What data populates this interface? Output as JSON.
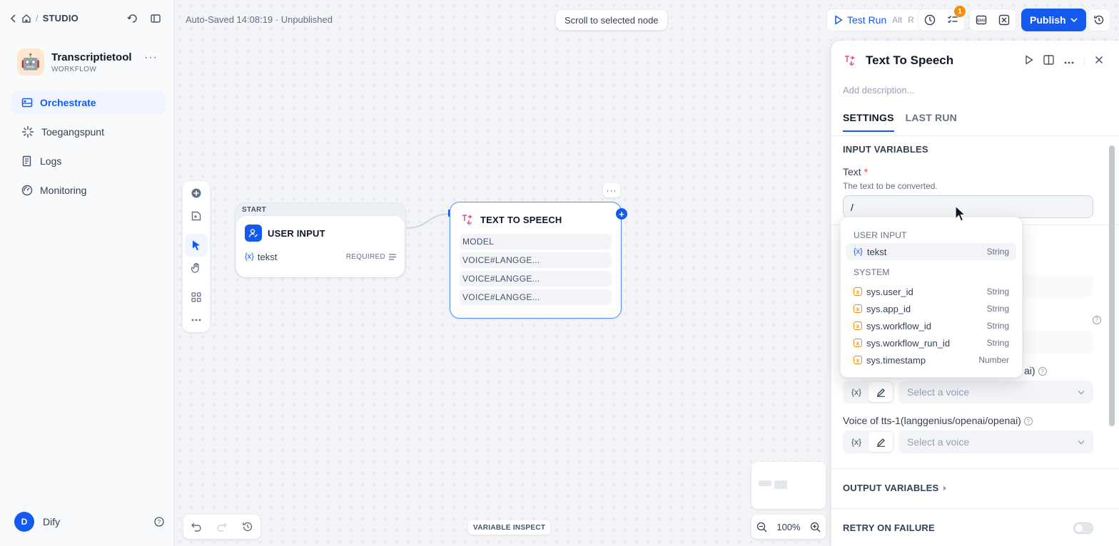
{
  "breadcrumb": {
    "studio": "STUDIO"
  },
  "app": {
    "name": "Transcriptietool",
    "type": "WORKFLOW",
    "icon": "robot-emoji",
    "avatar_emoji": "🤖"
  },
  "sidebar": {
    "items": [
      {
        "label": "Orchestrate",
        "icon": "orchestrate-icon",
        "active": true
      },
      {
        "label": "Toegangspunt",
        "icon": "api-access-icon",
        "active": false
      },
      {
        "label": "Logs",
        "icon": "logs-icon",
        "active": false
      },
      {
        "label": "Monitoring",
        "icon": "monitoring-icon",
        "active": false
      }
    ]
  },
  "user": {
    "initial": "D",
    "name": "Dify"
  },
  "header": {
    "autosave": "Auto-Saved 14:08:19 · Unpublished",
    "scroll_to_selected": "Scroll to selected node",
    "test_run": {
      "label": "Test Run",
      "shortcut_1": "Alt",
      "shortcut_2": "R"
    },
    "checklist_badge": "1",
    "publish": "Publish"
  },
  "nodes": {
    "start": {
      "badge": "START",
      "title": "USER INPUT",
      "variable": {
        "symbol": "{x}",
        "name": "tekst",
        "flag": "REQUIRED"
      }
    },
    "tts": {
      "title": "TEXT TO SPEECH",
      "fields": [
        "MODEL",
        "VOICE#LANGGE...",
        "VOICE#LANGGE...",
        "VOICE#LANGGE..."
      ],
      "more": "···",
      "plus": "+"
    }
  },
  "canvas": {
    "variable_inspect": "VARIABLE INSPECT",
    "zoom": "100%"
  },
  "panel": {
    "title": "Text To Speech",
    "description_placeholder": "Add description...",
    "tabs": [
      "SETTINGS",
      "LAST RUN"
    ],
    "input_variables": "INPUT VARIABLES",
    "text_field": {
      "label": "Text",
      "required": "*",
      "help": "The text to be converted.",
      "value": "/"
    },
    "voice_fields": [
      {
        "label": "Voice of tts-1(langgenius/openai/openai)",
        "placeholder": "Select a voice"
      },
      {
        "label": "Voice of tts-1(langgenius/openai/openai)",
        "placeholder": "Select a voice"
      }
    ],
    "voice_label_tail": "ai)",
    "var_toggle": "{x}",
    "output_variables": "OUTPUT VARIABLES",
    "retry_on_failure": "RETRY ON FAILURE"
  },
  "dropdown": {
    "groups": [
      {
        "name": "USER INPUT",
        "items": [
          {
            "name": "tekst",
            "type": "String",
            "kind": "user"
          }
        ]
      },
      {
        "name": "SYSTEM",
        "items": [
          {
            "name": "sys.user_id",
            "type": "String",
            "kind": "system"
          },
          {
            "name": "sys.app_id",
            "type": "String",
            "kind": "system"
          },
          {
            "name": "sys.workflow_id",
            "type": "String",
            "kind": "system"
          },
          {
            "name": "sys.workflow_run_id",
            "type": "String",
            "kind": "system"
          },
          {
            "name": "sys.timestamp",
            "type": "Number",
            "kind": "system"
          }
        ]
      }
    ]
  },
  "colors": {
    "accent": "#155aef",
    "system_var": "#f79009",
    "badge": "#f79009",
    "tts_icon": "#e74694"
  }
}
